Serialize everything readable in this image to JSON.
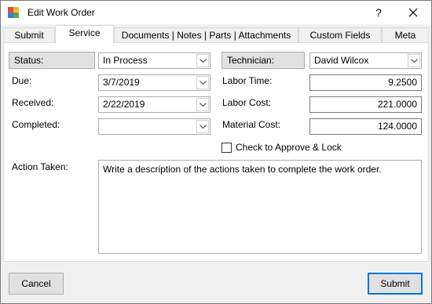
{
  "window": {
    "title": "Edit Work Order",
    "help_glyph": "?",
    "app_icon": "work-order-app-icon",
    "close_icon": "close-icon"
  },
  "tabs": [
    {
      "label": "Submit",
      "active": false
    },
    {
      "label": "Service",
      "active": true
    },
    {
      "label": "Documents | Notes | Parts | Attachments",
      "active": false
    },
    {
      "label": "Custom Fields",
      "active": false
    },
    {
      "label": "Meta",
      "active": false
    }
  ],
  "service": {
    "status": {
      "label": "Status:",
      "value": "In Process"
    },
    "technician": {
      "label": "Technician:",
      "value": "David Wilcox"
    },
    "due": {
      "label": "Due:",
      "value": "3/7/2019"
    },
    "received": {
      "label": "Received:",
      "value": "2/22/2019"
    },
    "completed": {
      "label": "Completed:",
      "value": ""
    },
    "labor_time": {
      "label": "Labor Time:",
      "value": "9.2500"
    },
    "labor_cost": {
      "label": "Labor Cost:",
      "value": "221.0000"
    },
    "material_cost": {
      "label": "Material Cost:",
      "value": "124.0000"
    },
    "approve": {
      "label": "Check to Approve & Lock",
      "checked": false
    },
    "action_taken": {
      "label": "Action Taken:",
      "value": "Write a description of the actions taken to complete the work order."
    }
  },
  "buttons": {
    "cancel": "Cancel",
    "submit": "Submit"
  },
  "colors": {
    "accent": "#0078d7",
    "window_bg": "#f0f0f0",
    "panel_bg": "#ffffff"
  }
}
